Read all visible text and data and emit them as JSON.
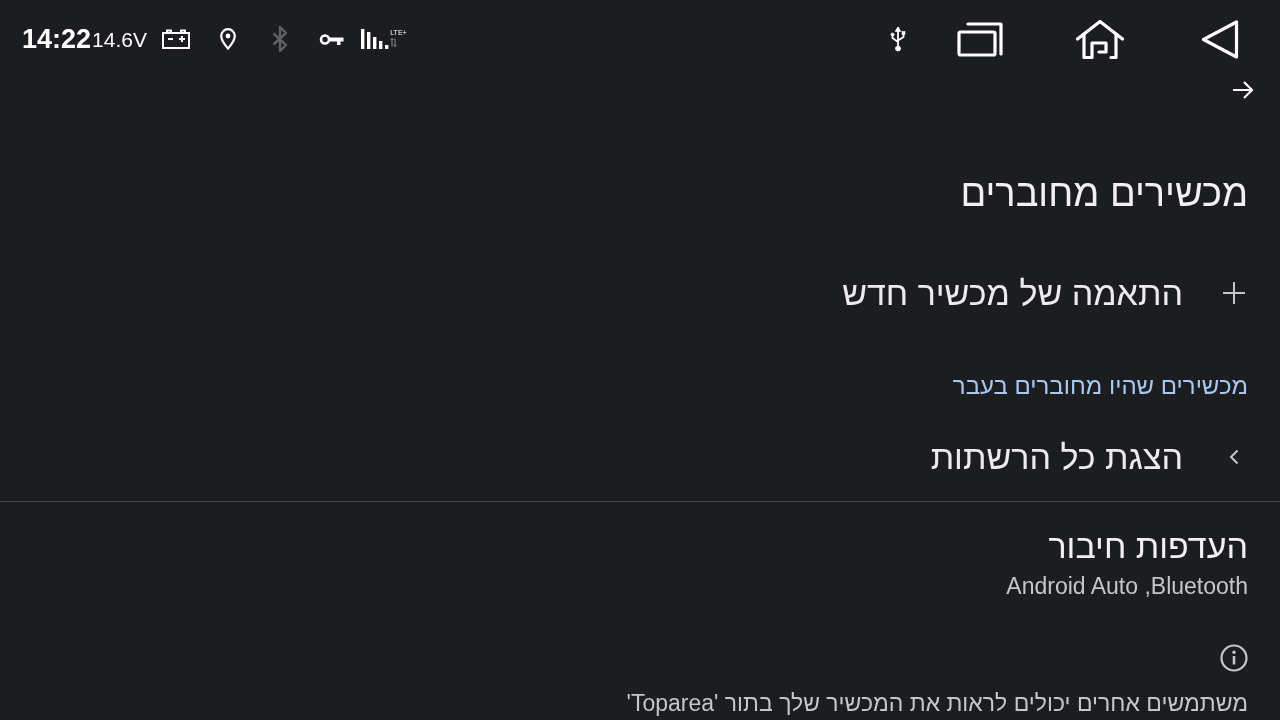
{
  "status_bar": {
    "time": "14:22",
    "voltage": "14.6V",
    "icons": [
      {
        "kind": "battery",
        "active": true
      },
      {
        "kind": "location",
        "active": true
      },
      {
        "kind": "bluetooth",
        "active": false
      },
      {
        "kind": "vpn-key",
        "active": true
      },
      {
        "kind": "signal",
        "active": true,
        "label": "LTE+"
      }
    ],
    "tray_icons": [
      {
        "kind": "usb"
      }
    ],
    "nav_buttons": [
      {
        "kind": "recents"
      },
      {
        "kind": "home"
      },
      {
        "kind": "back"
      }
    ]
  },
  "page": {
    "title": "מכשירים מחוברים",
    "items": [
      {
        "kind": "add",
        "label": "התאמה של מכשיר חדש"
      },
      {
        "kind": "section_header",
        "label": "מכשירים שהיו מחוברים בעבר"
      },
      {
        "kind": "link",
        "label": "הצגת כל הרשתות"
      },
      {
        "kind": "divider"
      },
      {
        "kind": "preference",
        "title": "העדפות חיבור",
        "summary": "Android Auto ,Bluetooth"
      },
      {
        "kind": "footer",
        "label": "משתמשים אחרים יכולים לראות את המכשיר שלך בתור 'Toparea'"
      }
    ]
  }
}
